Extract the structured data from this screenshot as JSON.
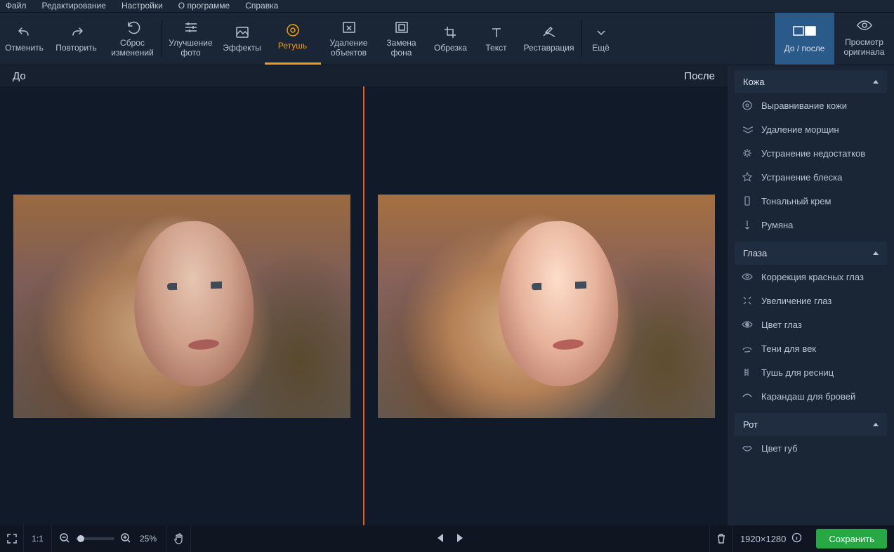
{
  "menu": [
    "Файл",
    "Редактирование",
    "Настройки",
    "О программе",
    "Справка"
  ],
  "toolbar": {
    "undo": "Отменить",
    "redo": "Повторить",
    "reset": "Сброс\nизменений",
    "enhance": "Улучшение\nфото",
    "effects": "Эффекты",
    "retouch": "Ретушь",
    "remove": "Удаление\nобъектов",
    "bg": "Замена\nфона",
    "crop": "Обрезка",
    "text": "Текст",
    "restore": "Реставрация",
    "more": "Ещё",
    "before_after": "До / после",
    "original": "Просмотр\nоригинала"
  },
  "canvas": {
    "before": "До",
    "after": "После"
  },
  "sidebar": {
    "skin": {
      "title": "Кожа",
      "items": [
        "Выравнивание кожи",
        "Удаление морщин",
        "Устранение недостатков",
        "Устранение блеска",
        "Тональный крем",
        "Румяна"
      ]
    },
    "eyes": {
      "title": "Глаза",
      "items": [
        "Коррекция красных глаз",
        "Увеличение глаз",
        "Цвет глаз",
        "Тени для век",
        "Тушь для ресниц",
        "Карандаш для бровей"
      ]
    },
    "mouth": {
      "title": "Рот",
      "items": [
        "Цвет губ"
      ]
    }
  },
  "footer": {
    "fit": "1:1",
    "zoom": "25%",
    "dims": "1920×1280",
    "save": "Сохранить"
  }
}
